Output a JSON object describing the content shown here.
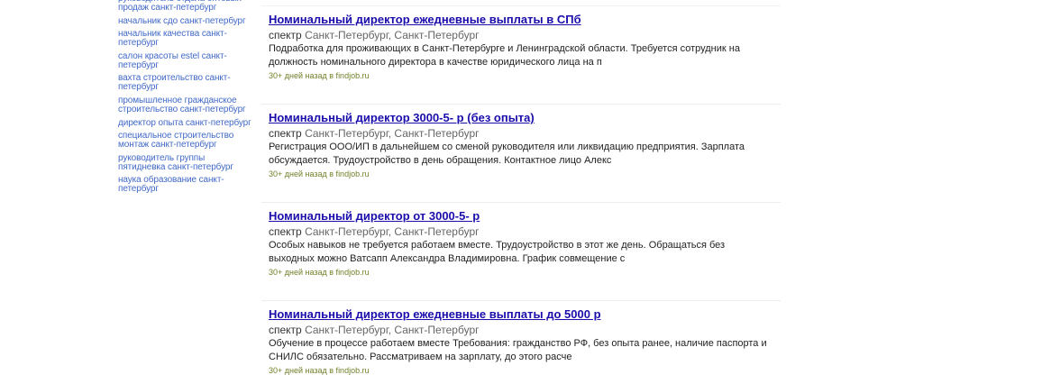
{
  "sidebar": {
    "links": [
      "руководитель отдела оптовых продаж санкт-петербург",
      "начальник сдо санкт-петербург",
      "начальник качества санкт-петербург",
      "салон красоты estel санкт-петербург",
      "вахта строительство санкт-петербург",
      "промышленное гражданское строительство санкт-петербург",
      "директор опыта санкт-петербург",
      "специальное строительство монтаж санкт-петербург",
      "руководитель группы пятидневка санкт-петербург",
      "наука образование санкт-петербург"
    ]
  },
  "results": [
    {
      "title": "Номинальный директор ежедневные выплаты в СПб",
      "company": "спектр",
      "location": "Санкт-Петербург, Санкт-Петербург",
      "description": "Подработка для проживающих в Санкт-Петербурге и Ленинградской области. Требуется сотрудник на должность номинального директора в качестве юридического лица на п",
      "date": "30+ дней назад в findjob.ru"
    },
    {
      "title": "Номинальный директор 3000-5- р (без опыта)",
      "company": "спектр",
      "location": "Санкт-Петербург, Санкт-Петербург",
      "description": "Регистрация ООО/ИП в дальнейшем со сменой руководителя или ликвидацию предприятия. Зарплата обсуждается. Трудоустройство в день обращения. Контактное лицо Алекс",
      "date": "30+ дней назад в findjob.ru"
    },
    {
      "title": "Номинальный директор от 3000-5- р",
      "company": "спектр",
      "location": "Санкт-Петербург, Санкт-Петербург",
      "description": "Особых навыков не требуется работаем вместе. Трудоустройство в этот же день. Обращаться без выходных можно Ватсапп Александра Владимировна. График совмещение с",
      "date": "30+ дней назад в findjob.ru"
    },
    {
      "title": "Номинальный директор ежедневные выплаты до 5000 р",
      "company": "спектр",
      "location": "Санкт-Петербург, Санкт-Петербург",
      "description": "Обучение в процессе работаем вместе Требования: гражданство РФ, без опыта ранее, наличие паспорта и СНИЛС обязательно. Рассматриваем на зарплату, до этого расче",
      "date": "30+ дней назад в findjob.ru"
    }
  ],
  "colors": {
    "sidebar_link": "#4169c8",
    "title_link": "#1a0dab",
    "date": "#70822a"
  }
}
